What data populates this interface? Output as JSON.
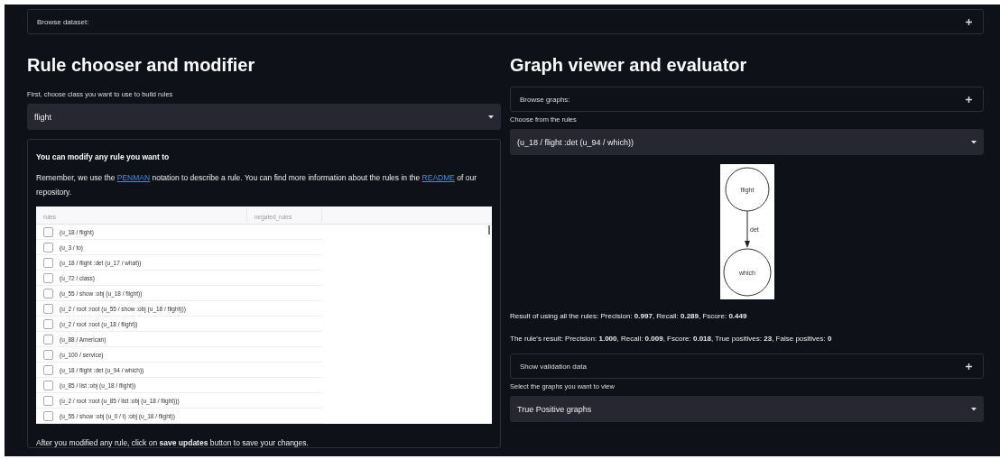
{
  "top_expander": {
    "label": "Browse dataset:",
    "expanded": false
  },
  "left": {
    "heading": "Rule chooser and modifier",
    "class_label": "First, choose class you want to use to build rules",
    "class_select": "flight",
    "panel": {
      "title": "You can modify any rule you want to",
      "paragraph": [
        {
          "kind": "text",
          "text": "Remember, we use the "
        },
        {
          "kind": "link",
          "text": "PENMAN"
        },
        {
          "kind": "text",
          "text": " notation to describe a rule. You can find more information about the rules in the "
        },
        {
          "kind": "link",
          "text": "README"
        },
        {
          "kind": "text",
          "text": " of our repository."
        }
      ],
      "table": {
        "columns": [
          "rules",
          "negated_rules"
        ],
        "rows": [
          {
            "rule": "(u_18 / flight)",
            "checked": false
          },
          {
            "rule": "(u_3 / to)",
            "checked": false
          },
          {
            "rule": "(u_18 / flight :det (u_17 / what))",
            "checked": false
          },
          {
            "rule": "(u_72 / class)",
            "checked": false
          },
          {
            "rule": "(u_55 / show :obj (u_18 / flight))",
            "checked": false
          },
          {
            "rule": "(u_2 / root :root (u_55 / show :obj (u_18 / flight)))",
            "checked": false
          },
          {
            "rule": "(u_2 / root :root (u_18 / flight))",
            "checked": false
          },
          {
            "rule": "(u_88 / American)",
            "checked": false
          },
          {
            "rule": "(u_100 / service)",
            "checked": false
          },
          {
            "rule": "(u_18 / flight :det (u_94 / which))",
            "checked": false
          },
          {
            "rule": "(u_85 / list :obj (u_18 / flight))",
            "checked": false
          },
          {
            "rule": "(u_2 / root :root (u_85 / list :obj (u_18 / flight)))",
            "checked": false
          },
          {
            "rule": "(u_55 / show :obj (u_0 / I) :obj (u_18 / flight))",
            "checked": false
          }
        ]
      },
      "footer": "After you modified any rule, click on **save updates** button to save your changes."
    }
  },
  "right": {
    "heading": "Graph viewer and evaluator",
    "browse_expander": {
      "label": "Browse graphs:",
      "expanded": false
    },
    "rule_label": "Choose from the rules",
    "rule_select": "(u_18 / flight :det (u_94 / which))",
    "graph": {
      "source": "flight",
      "edge": "det",
      "target": "which"
    },
    "all_result": "Result of using all the rules: Precision: **0.997**, Recall: **0.289**, Fscore: **0.449**",
    "rule_result": "The rule's result: Precision: **1.000**, Recall: **0.009**, Fscore: **0.018**, True positives: **23**, False positives: **0**",
    "validation_expander": {
      "label": "Show validation data",
      "expanded": false
    },
    "graphs_label": "Select the graphs you want to view",
    "graphs_select": "True Positive graphs"
  }
}
